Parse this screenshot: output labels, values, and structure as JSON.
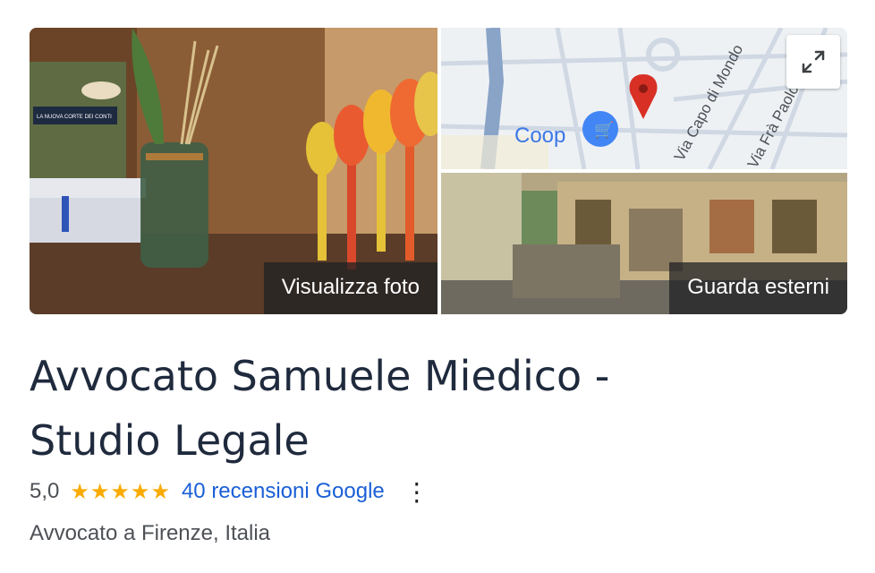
{
  "media": {
    "photo_label": "Visualizza foto",
    "street_label": "Guarda esterni",
    "map": {
      "poi_label": "Coop",
      "street_1": "Via Capo di Mondo",
      "street_2": "Via Frà Paolo Sarpi"
    },
    "photo_book_title": "LA NUOVA CORTE DEI CONTI"
  },
  "business": {
    "title_line_1": "Avvocato Samuele Miedico -",
    "title_line_2": "Studio Legale",
    "rating_value": "5,0",
    "stars": "★★★★★",
    "reviews_link": "40 recensioni Google",
    "more_icon": "⋮",
    "category": "Avvocato a Firenze, Italia"
  },
  "colors": {
    "title": "#1f2a3d",
    "link": "#1a5fd6",
    "star": "#f9ab00",
    "map_pin": "#d93025",
    "poi": "#4285f4"
  }
}
